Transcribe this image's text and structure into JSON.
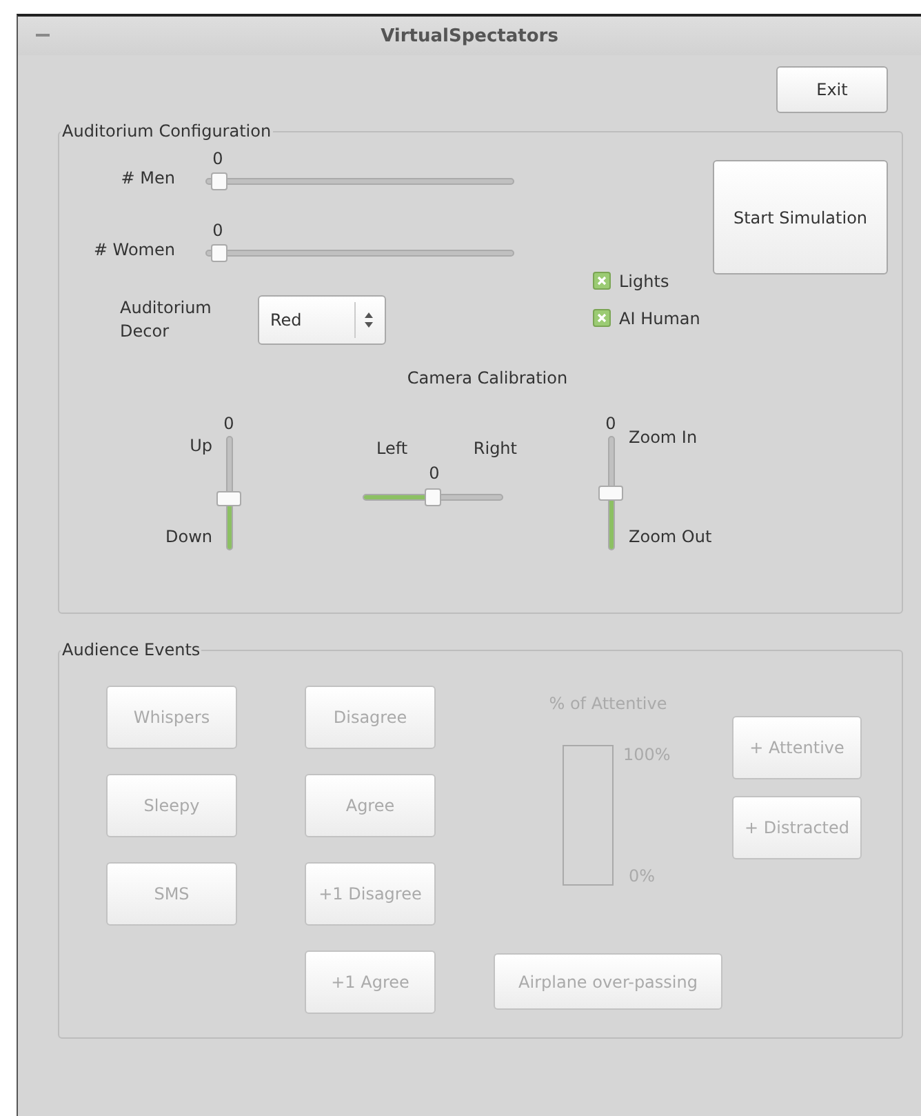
{
  "window": {
    "title": "VirtualSpectators"
  },
  "exit_button": "Exit",
  "auditorium_configuration": {
    "title": "Auditorium Configuration",
    "sliders": [
      {
        "label": "# Men",
        "value": "0",
        "level": 0
      },
      {
        "label": "# Women",
        "value": "0",
        "level": 0
      }
    ],
    "start_button": "Start Simulation",
    "checkboxes": [
      {
        "label": "Lights",
        "checked": true
      },
      {
        "label": "AI Human",
        "checked": true
      }
    ],
    "decor": {
      "label": "Auditorium Decor",
      "value": "Red"
    },
    "camera": {
      "title": "Camera Calibration",
      "tilt": {
        "value": "0",
        "top_label": "Up",
        "bottom_label": "Down",
        "level": 0.45
      },
      "pan": {
        "value": "0",
        "left_label": "Left",
        "right_label": "Right",
        "level": 0.5
      },
      "zoom": {
        "value": "0",
        "top_label": "Zoom In",
        "bottom_label": "Zoom Out",
        "level": 0.5
      }
    }
  },
  "audience_events": {
    "title": "Audience Events",
    "disabled": true,
    "column_1": [
      "Whispers",
      "Sleepy",
      "SMS"
    ],
    "column_2": [
      "Disagree",
      "Agree",
      "+1 Disagree",
      "+1 Agree"
    ],
    "attentive": {
      "title": "% of Attentive",
      "max_label": "100%",
      "min_label": "0%",
      "level": 0
    },
    "attentive_buttons": [
      "+ Attentive",
      "+ Distracted"
    ],
    "airplane_button": "Airplane over-passing"
  }
}
